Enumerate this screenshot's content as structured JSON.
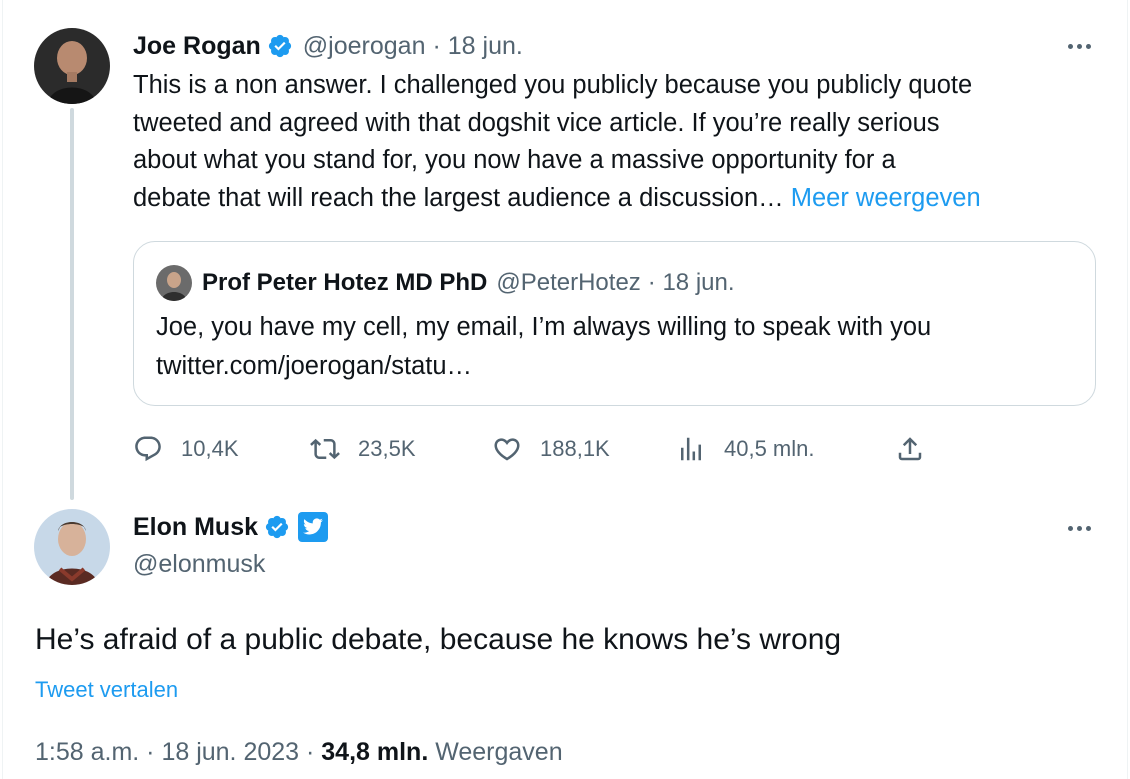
{
  "colors": {
    "accent": "#1d9bf0",
    "muted": "#536471",
    "text": "#0f1419",
    "border": "#cfd9de"
  },
  "original_tweet": {
    "author_name": "Joe Rogan",
    "handle": "@joerogan",
    "date": "· 18 jun.",
    "text_lines": [
      "This is a non answer.  I challenged you publicly because you publicly quote",
      "tweeted and agreed with that dogshit vice article.  If you’re really serious",
      "about what you stand for, you now have a massive opportunity for a",
      "debate that will reach the largest audience a discussion… "
    ],
    "show_more": "Meer weergeven",
    "quoted": {
      "author_name": "Prof Peter Hotez MD PhD",
      "handle": "@PeterHotez",
      "date": "· 18 jun.",
      "text_lines": [
        "Joe, you have my cell, my email, I’m always willing to speak with you",
        "twitter.com/joerogan/statu…"
      ]
    },
    "stats": {
      "replies": "10,4K",
      "retweets": "23,5K",
      "likes": "188,1K",
      "views": "40,5 mln."
    },
    "icons": [
      "reply-icon",
      "retweet-icon",
      "like-icon",
      "views-icon",
      "share-icon",
      "more-icon",
      "verified-icon"
    ]
  },
  "reply_tweet": {
    "author_name": "Elon Musk",
    "handle": "@elonmusk",
    "text": "He’s afraid of a public debate, because he knows he’s wrong",
    "translate": "Tweet vertalen",
    "time": "1:58 a.m. · 18 jun. 2023 · ",
    "views_count": "34,8 mln.",
    "views_label": " Weergaven",
    "icons": [
      "verified-icon",
      "twitter-affiliate-badge",
      "more-icon"
    ]
  }
}
